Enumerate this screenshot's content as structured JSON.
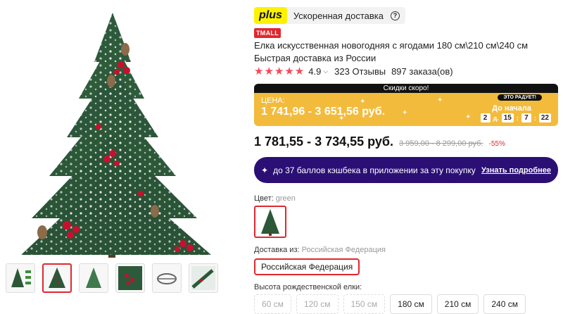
{
  "gallery": {
    "main_image_icon": "christmas-tree-image",
    "thumbnails": [
      {
        "icon": "tree-with-sizes-thumb",
        "active": false
      },
      {
        "icon": "tree-thumb",
        "active": true
      },
      {
        "icon": "tree-green-thumb",
        "active": false
      },
      {
        "icon": "tree-berries-closeup-thumb",
        "active": false
      },
      {
        "icon": "tree-stand-thumb",
        "active": false
      },
      {
        "icon": "tree-branch-thumb",
        "active": false
      }
    ]
  },
  "plus": {
    "badge": "plus",
    "text": "Ускоренная доставка",
    "help_icon": "?"
  },
  "tmall_badge": "TMALL",
  "product_title": "Елка искусственная новогодняя с ягодами 180 см\\210 см\\240 см Быстрая доставка из России",
  "rating": {
    "stars": "★★★★★",
    "value": "4.9",
    "reviews": "323 Отзывы",
    "orders": "897 заказа(ов)"
  },
  "promo": {
    "banner": "Скидки скоро!",
    "price_label": "ЦЕНА:",
    "price": "1 741,96 - 3 651,56 руб.",
    "slogan": "ЭТО РАДУЕТ!",
    "until_label": "До начала",
    "timer": {
      "days": "2",
      "days_unit": "д.",
      "hours": "15",
      "minutes": "7",
      "seconds": "22"
    },
    "colors": {
      "background": "#f3bb3c",
      "top_bar": "#111111"
    }
  },
  "price": {
    "current": "1 781,55 - 3 734,55 руб.",
    "old": "3 959,00 - 8 299,00 руб.",
    "discount": "-55%"
  },
  "cashback": {
    "text": "до 37 баллов кэшбека в приложении за эту покупку",
    "link": "Узнать подробнее",
    "color": "#2b0f75"
  },
  "color_option": {
    "label": "Цвет:",
    "value": "green"
  },
  "shipping": {
    "label": "Доставка из:",
    "value": "Российская Федерация",
    "button": "Российская Федерация"
  },
  "height": {
    "label": "Высота рождественской елки:",
    "options": [
      {
        "label": "60 см",
        "available": false
      },
      {
        "label": "120 см",
        "available": false
      },
      {
        "label": "150 см",
        "available": false
      },
      {
        "label": "180 см",
        "available": true
      },
      {
        "label": "210 см",
        "available": true
      },
      {
        "label": "240 см",
        "available": true
      }
    ]
  },
  "accent_color": "#e0282e"
}
